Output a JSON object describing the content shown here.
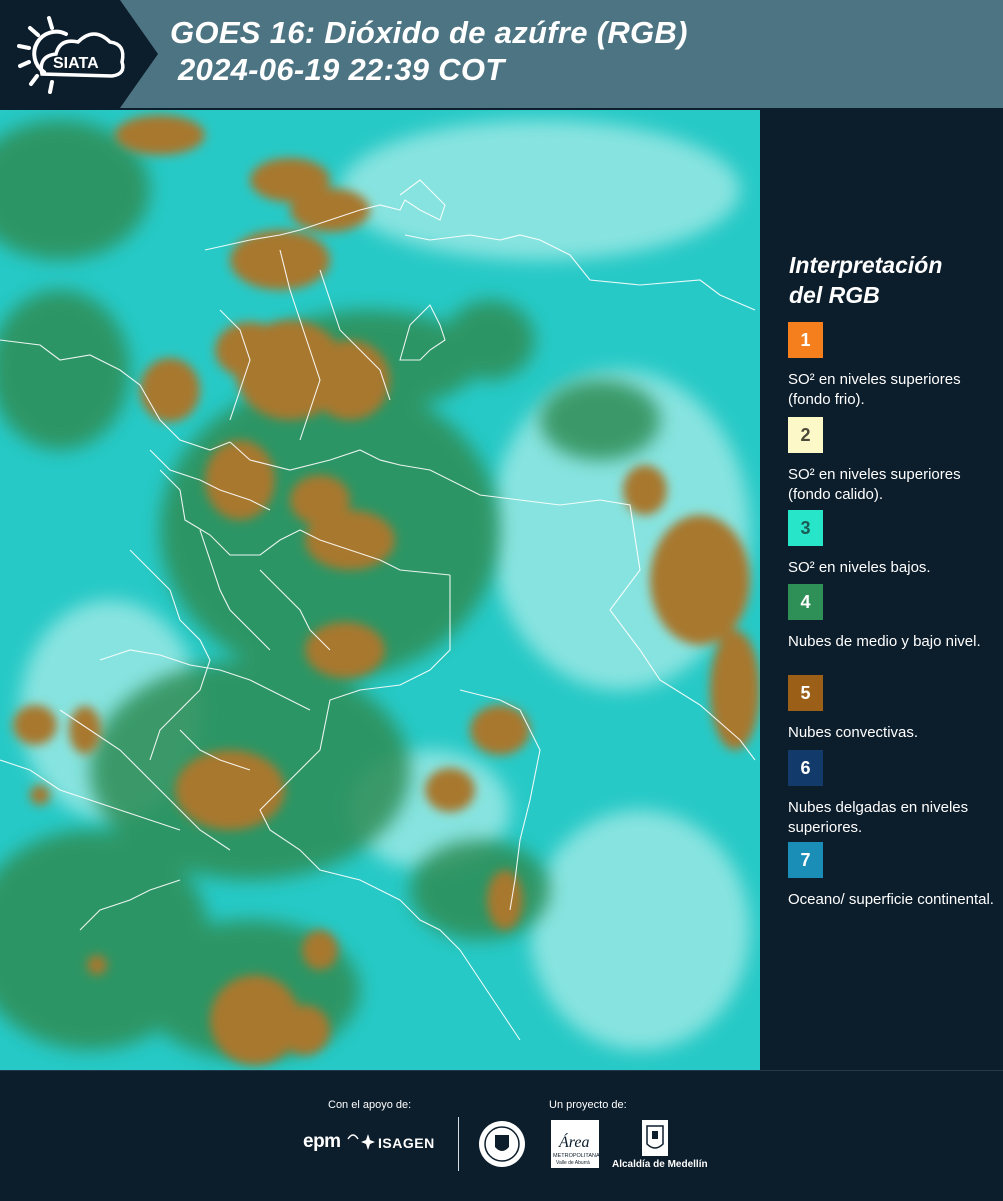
{
  "header": {
    "logo_text": "SIATA",
    "title_line1": "GOES 16: Dióxido de azúfre (RGB)",
    "title_line2": "2024-06-19 22:39 COT"
  },
  "legend": {
    "title_line1": "Interpretación",
    "title_line2": "del RGB",
    "items": [
      {
        "number": "1",
        "color": "#f47f1c",
        "text_color": "#ffffff",
        "text": "SO² en niveles superiores (fondo frio)."
      },
      {
        "number": "2",
        "color": "#fdf8c8",
        "text_color": "#4a4a3a",
        "text": "SO² en niveles superiores (fondo calido)."
      },
      {
        "number": "3",
        "color": "#27e5c9",
        "text_color": "#1c5a55",
        "text": "SO² en niveles bajos."
      },
      {
        "number": "4",
        "color": "#2f9057",
        "text_color": "#ffffff",
        "text": "Nubes de medio y bajo nivel."
      },
      {
        "number": "5",
        "color": "#9b5f17",
        "text_color": "#ffffff",
        "text": "Nubes convectivas."
      },
      {
        "number": "6",
        "color": "#123a6b",
        "text_color": "#ffffff",
        "text": "Nubes delgadas en niveles superiores."
      },
      {
        "number": "7",
        "color": "#1b8eb8",
        "text_color": "#ffffff",
        "text": "Oceano/ superficie continental."
      }
    ]
  },
  "footer": {
    "support_label": "Con el apoyo de:",
    "project_label": "Un proyecto de:",
    "sponsor1": "epm",
    "sponsor2": "ISAGEN",
    "partner_area_text": "Área",
    "partner_area_sub": "METROPOLITANA",
    "partner_area_sub2": "Valle de Aburrá",
    "partner_alcaldia": "Alcaldía de Medellín"
  },
  "colors": {
    "background": "#0c1d2b",
    "header_band": "#4d7482",
    "map_cyan": "#27c9c6",
    "map_green": "#2e8d55",
    "map_orange": "#a7782d"
  }
}
